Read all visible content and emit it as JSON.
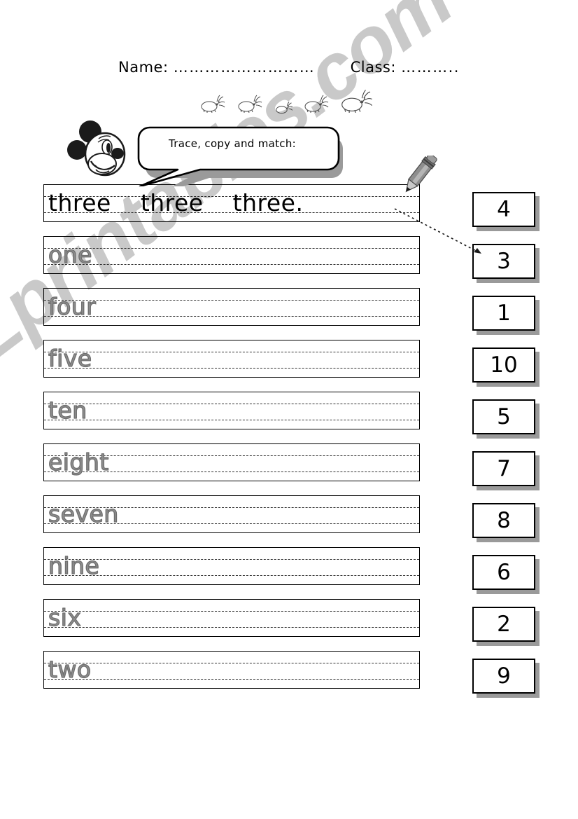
{
  "header": {
    "name_label": "Name:",
    "name_dots": "………………………",
    "class_label": "Class:",
    "class_dots": "……….."
  },
  "instruction": {
    "bubble_text": "Trace, copy and match:"
  },
  "icons": {
    "mickey": "mickey-mouse-head-icon",
    "pencil": "pencil-icon",
    "bunny": "bunny-icon",
    "arrow": "match-arrow-icon"
  },
  "watermark": {
    "text": "ESLprintables.com",
    "color": "#c9c9c9"
  },
  "worksheet": {
    "sample_row": {
      "word": "three",
      "repeat_1": "three",
      "repeat_2": "three",
      "trailing": "."
    },
    "trace_rows": [
      {
        "word": "one"
      },
      {
        "word": "four"
      },
      {
        "word": "five"
      },
      {
        "word": "ten"
      },
      {
        "word": "eight"
      },
      {
        "word": "seven"
      },
      {
        "word": "nine"
      },
      {
        "word": "six"
      },
      {
        "word": "two"
      }
    ]
  },
  "number_boxes": [
    {
      "value": "4"
    },
    {
      "value": "3"
    },
    {
      "value": "1"
    },
    {
      "value": "10"
    },
    {
      "value": "5"
    },
    {
      "value": "7"
    },
    {
      "value": "8"
    },
    {
      "value": "6"
    },
    {
      "value": "2"
    },
    {
      "value": "9"
    }
  ],
  "colors": {
    "ink": "#000000",
    "trace_gray": "#8d8d8d",
    "shadow_gray": "#9a9a9a",
    "watermark_gray": "#c9c9c9"
  }
}
